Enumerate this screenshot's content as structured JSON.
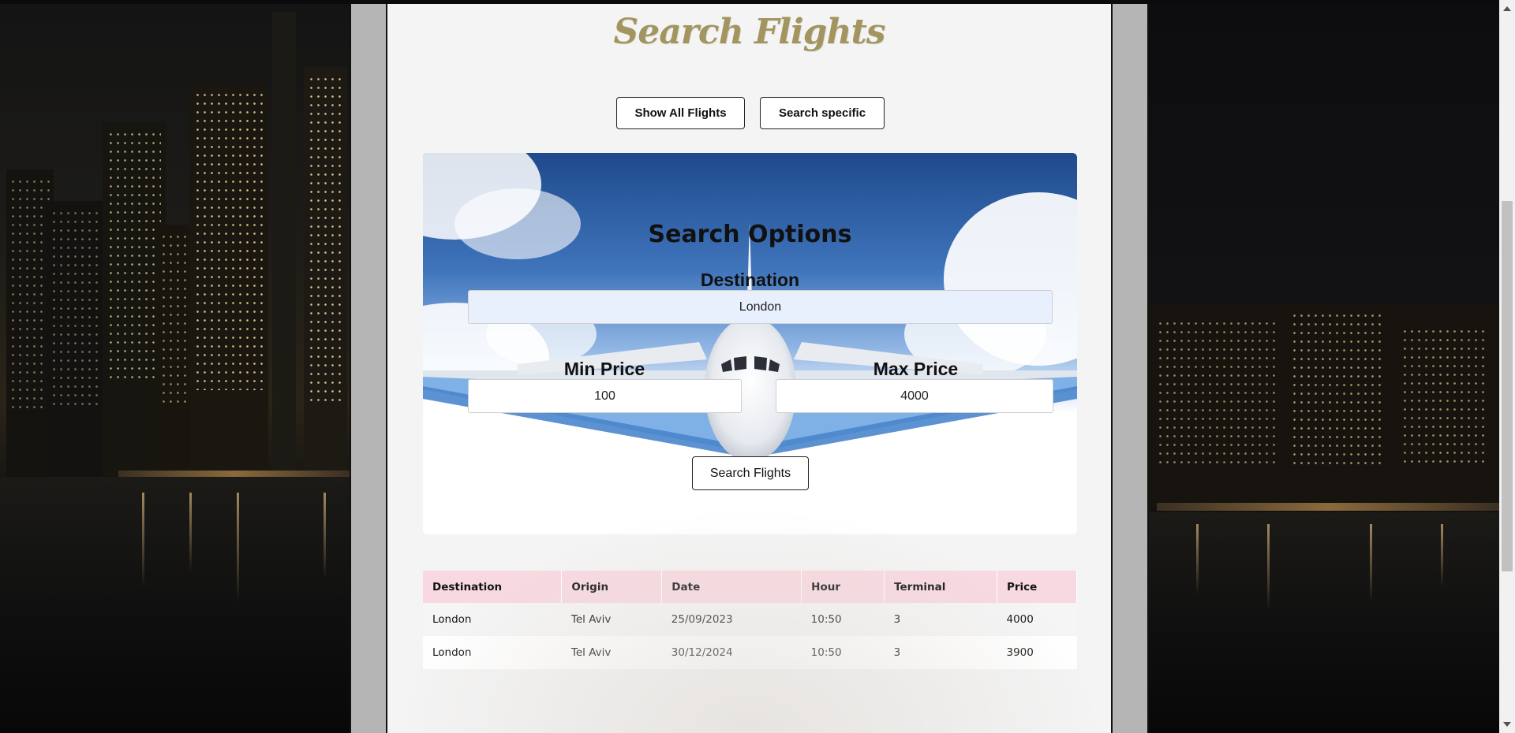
{
  "header": {
    "title": "Search Flights",
    "buttons": {
      "show_all": "Show All Flights",
      "search_specific": "Search specific"
    }
  },
  "search": {
    "title": "Search Options",
    "destination_label": "Destination",
    "destination_value": "London",
    "min_price_label": "Min Price",
    "min_price_value": "100",
    "max_price_label": "Max Price",
    "max_price_value": "4000",
    "submit_label": "Search Flights"
  },
  "results": {
    "columns": [
      "Destination",
      "Origin",
      "Date",
      "Hour",
      "Terminal",
      "Price"
    ],
    "rows": [
      [
        "London",
        "Tel Aviv",
        "25/09/2023",
        "10:50",
        "3",
        "4000"
      ],
      [
        "London",
        "Tel Aviv",
        "30/12/2024",
        "10:50",
        "3",
        "3900"
      ]
    ]
  },
  "colors": {
    "title_gold": "#a39560",
    "table_header": "#f8d9e1",
    "sky_blue": "#2f5fa0",
    "destination_field": "#e8f0fe"
  },
  "icons": [
    "scroll-up-icon",
    "scroll-down-icon"
  ]
}
